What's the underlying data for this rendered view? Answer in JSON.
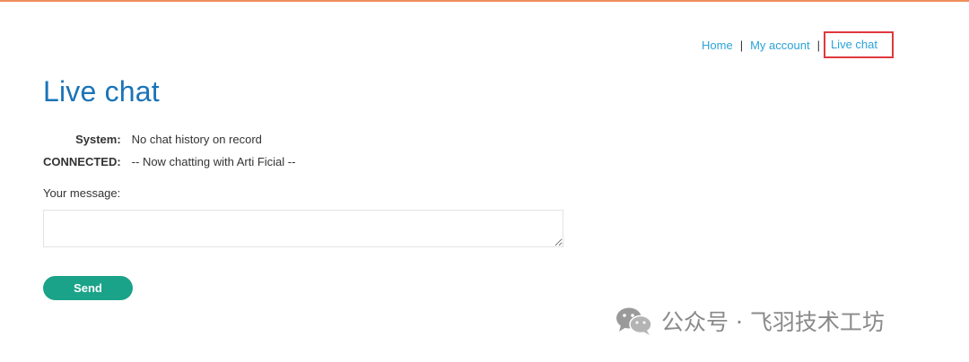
{
  "nav": {
    "home": "Home",
    "separator": "|",
    "my_account": "My account",
    "live_chat": "Live chat"
  },
  "page": {
    "title": "Live chat"
  },
  "chat": {
    "messages": [
      {
        "sender": "System:",
        "text": "No chat history on record"
      },
      {
        "sender": "CONNECTED:",
        "text": "-- Now chatting with Arti Ficial --"
      }
    ]
  },
  "form": {
    "message_label": "Your message:",
    "message_value": "",
    "send_label": "Send"
  },
  "watermark": {
    "text": "公众号 · 飞羽技术工坊"
  },
  "colors": {
    "top_bar": "#ee8f5a",
    "link": "#2aa3d8",
    "title": "#1a74b8",
    "send_button": "#1aa388",
    "highlight_box": "#e0393e"
  }
}
